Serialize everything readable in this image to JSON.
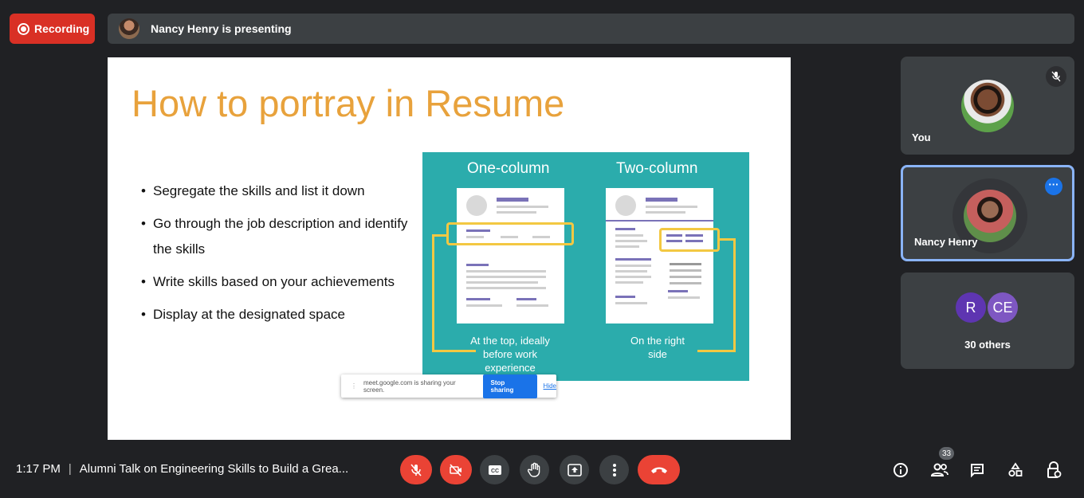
{
  "topbar": {
    "recording_label": "Recording",
    "presenting_text": "Nancy Henry is presenting"
  },
  "slide": {
    "title": "How to portray in Resume",
    "bullets": [
      "Segregate the skills and list it down",
      "Go through the job description and identify the skills",
      "Write skills based on your achievements",
      "Display at the designated space"
    ],
    "figure": {
      "left_heading": "One-column",
      "right_heading": "Two-column",
      "left_caption": "At the top, ideally before work experience",
      "right_caption": "On the right side"
    }
  },
  "share_popup": {
    "message": "meet.google.com is sharing your screen.",
    "stop_label": "Stop sharing",
    "hide_label": "Hide"
  },
  "tiles": {
    "you_label": "You",
    "presenter_label": "Nancy Henry",
    "others_avatars": [
      "R",
      "CE"
    ],
    "others_label": "30 others"
  },
  "bottombar": {
    "time": "1:17 PM",
    "meeting_title": "Alumni Talk on Engineering Skills to Build a Grea...",
    "participant_count": "33"
  },
  "colors": {
    "accent_red": "#ea4335",
    "accent_blue": "#1a73e8",
    "slide_title": "#e8a23c",
    "teal": "#2bacac"
  }
}
